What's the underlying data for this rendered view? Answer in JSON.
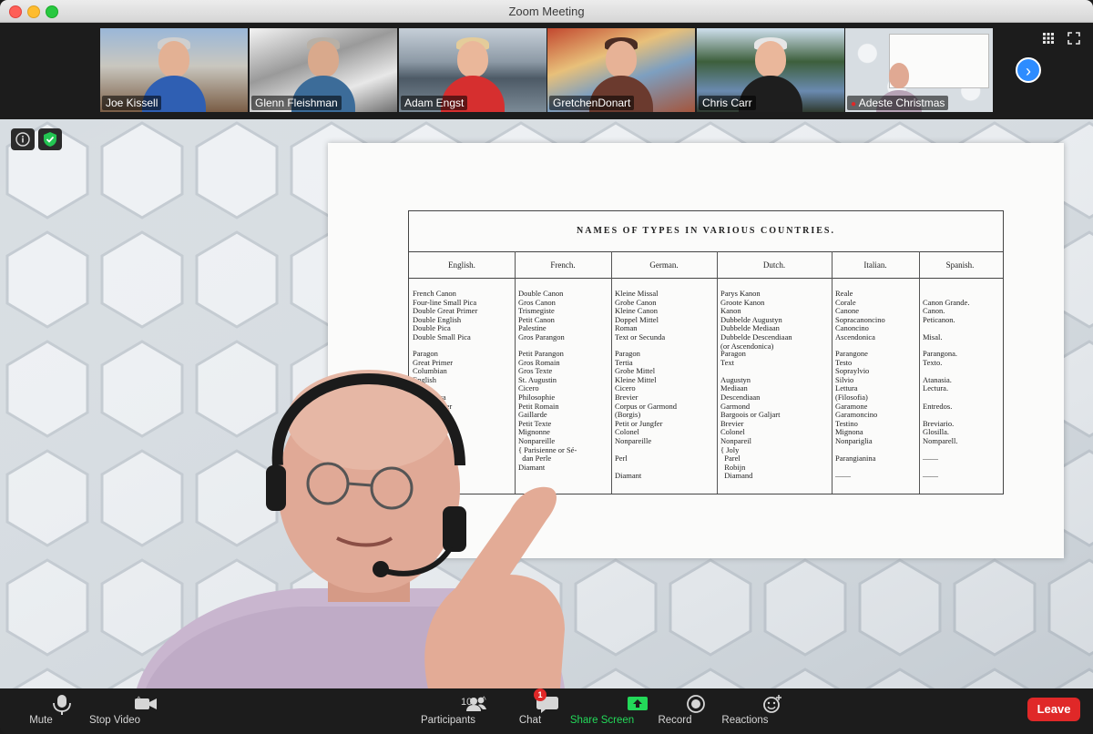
{
  "window": {
    "title": "Zoom Meeting"
  },
  "participants_strip": {
    "tiles": [
      {
        "name": "Joe Kissell"
      },
      {
        "name": "Glenn Fleishman"
      },
      {
        "name": "Adam Engst"
      },
      {
        "name": "GretchenDonart"
      },
      {
        "name": "Chris Carr"
      },
      {
        "name": "Adeste Christmas"
      }
    ],
    "next_icon": "chevron-right-icon"
  },
  "shared_document": {
    "caption": "NAMES OF TYPES IN VARIOUS COUNTRIES.",
    "columns": [
      "English.",
      "French.",
      "German.",
      "Dutch.",
      "Italian.",
      "Spanish."
    ],
    "rows_block1": [
      "French Canon\nFour-line Small Pica\nDouble Great Primer\nDouble English\nDouble Pica\nDouble Small Pica",
      "Double Canon\nGros Canon\nTrismegiste\nPetit Canon\nPalestine\nGros Parangon",
      "Kleine Missal\nGrobe Canon\nKleine Canon\nDoppel Mittel\nRoman\nText or Secunda",
      "Parys Kanon\nGroote Kanon\nKanon\nDubbelde Augustyn\nDubbelde Mediaan\nDubbelde Descendiaan\n(or Ascendonica)",
      "Reale\nCorale\nCanone\nSopracanoncino\nCanoncino\nAscendonica",
      "\nCanon Grande.\nCanon.\nPeticanon.\n\nMisal."
    ],
    "rows_block2": [
      "Paragon\nGreat Primer\nColumbian\nEnglish\nPica\nSmall Pica\nLong Primer\nBourgeois\nBrevier\nMinion\nNonpareil\nRuby\nPearl\nDiamond",
      "Petit Parangon\nGros Romain\nGros Texte\nSt. Augustin\nCicero\nPhilosophie\nPetit Romain\nGaillarde\nPetit Texte\nMignonne\nNonpareille\n{ Parisienne or Sé-\n  dan Perle\nDiamant",
      "Paragon\nTertia\nGrobe Mittel\nKleine Mittel\nCicero\nBrevier\nCorpus or Garmond\n(Borgis)\nPetit or Jungfer\nColonel\nNonpareille\n\nPerl\n\nDiamant",
      "Paragon\nText\n\nAugustyn\nMediaan\nDescendiaan\nGarmond\nBargoois or Galjart\nBrevier\nColonel\nNonpareil\n{ Joly\n  Parel\n  Robijn\n  Diamand",
      "Parangone\nTesto\nSopraylvio\nSilvio\nLettura\n(Filosofia)\nGaramone\nGaramoncino\nTestino\nMignona\nNonpariglia\n\nParangianina\n\n——",
      "Parangona.\nTexto.\n\nAtanasia.\nLectura.\n\nEntredos.\n\nBreviario.\nGlosilla.\nNomparell.\n\n——\n\n——"
    ]
  },
  "toolbar": {
    "mute": {
      "label": "Mute",
      "icon": "microphone-icon"
    },
    "video": {
      "label": "Stop Video",
      "icon": "video-camera-icon"
    },
    "participants": {
      "label": "Participants",
      "count": "10",
      "icon": "participants-icon"
    },
    "chat": {
      "label": "Chat",
      "badge": "1",
      "icon": "chat-icon"
    },
    "share": {
      "label": "Share Screen",
      "icon": "share-screen-icon"
    },
    "record": {
      "label": "Record",
      "icon": "record-icon"
    },
    "reactions": {
      "label": "Reactions",
      "icon": "emoji-plus-icon"
    },
    "leave": {
      "label": "Leave"
    }
  },
  "colors": {
    "accent_blue": "#2d8cff",
    "share_green": "#23d959",
    "leave_red": "#e02828",
    "active_speaker": "#c9d63a"
  }
}
